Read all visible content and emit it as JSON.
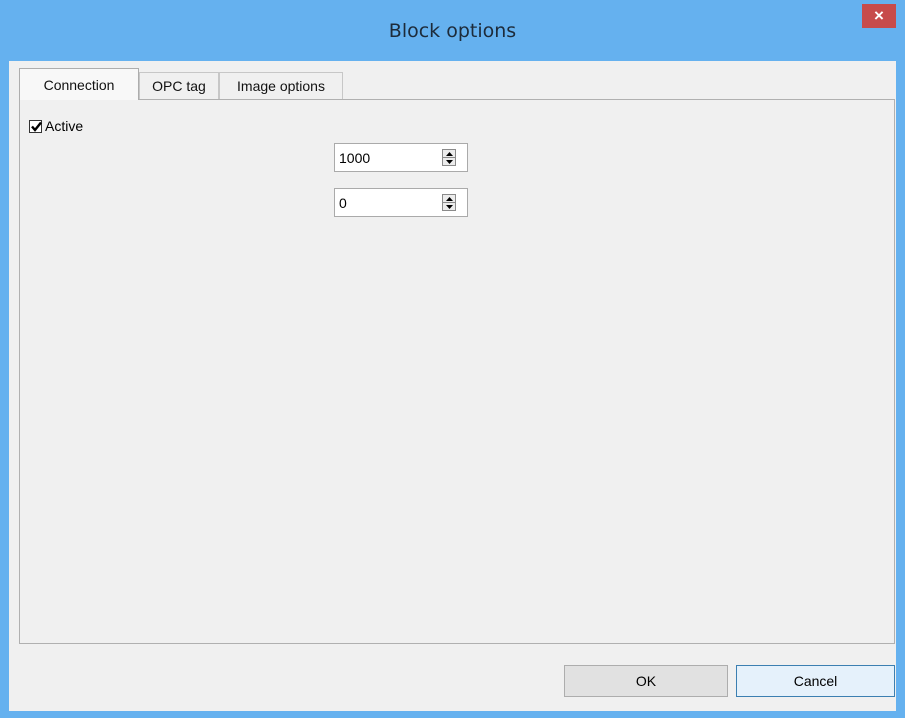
{
  "window": {
    "title": "Block options",
    "close_glyph": "×"
  },
  "tabs": [
    {
      "label": "Connection",
      "active": true
    },
    {
      "label": "OPC tag",
      "active": false
    },
    {
      "label": "Image options",
      "active": false
    }
  ],
  "connection": {
    "active_label": "Active",
    "active_checked": true,
    "field_1_value": "1000",
    "field_2_value": "0"
  },
  "buttons": {
    "ok_label": "OK",
    "cancel_label": "Cancel"
  },
  "icons": {
    "close": "close-icon",
    "check": "checkmark-icon",
    "spin_up": "arrow-up-icon",
    "spin_down": "arrow-down-icon"
  },
  "colors": {
    "titlebar": "#65b1ef",
    "close_button": "#c74b4b",
    "client_bg": "#f0f0f0"
  }
}
